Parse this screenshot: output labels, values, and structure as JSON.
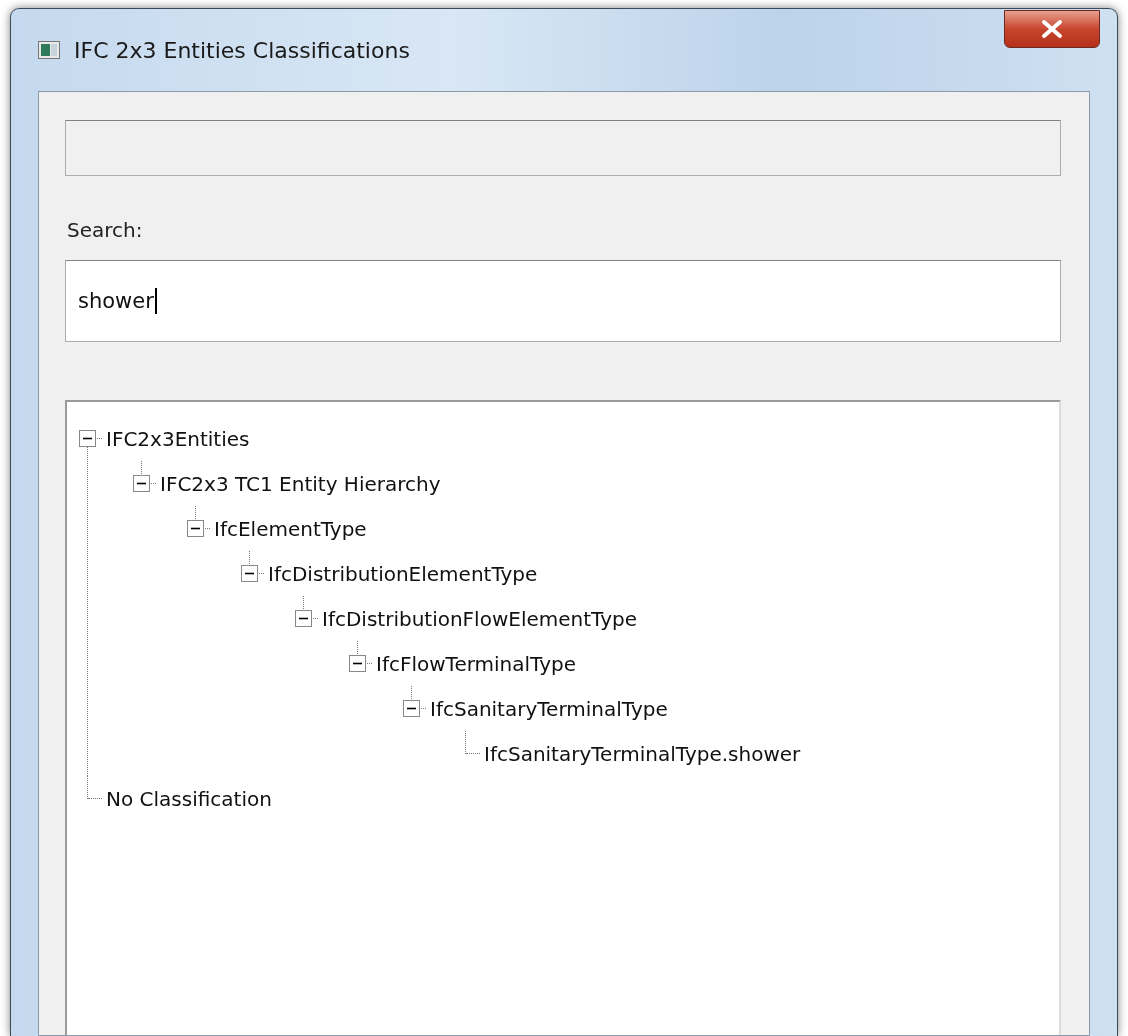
{
  "window": {
    "title": "IFC 2x3 Entities Classifications"
  },
  "status_field": {
    "disabled": true
  },
  "search": {
    "label": "Search:",
    "value": "shower",
    "focused": true
  },
  "tree": [
    {
      "label": "IFC2x3Entities",
      "expanded": true,
      "children": [
        {
          "label": "IFC2x3 TC1 Entity Hierarchy",
          "expanded": true,
          "children": [
            {
              "label": "IfcElementType",
              "expanded": true,
              "children": [
                {
                  "label": "IfcDistributionElementType",
                  "expanded": true,
                  "children": [
                    {
                      "label": "IfcDistributionFlowElementType",
                      "expanded": true,
                      "children": [
                        {
                          "label": "IfcFlowTerminalType",
                          "expanded": true,
                          "children": [
                            {
                              "label": "IfcSanitaryTerminalType",
                              "expanded": true,
                              "children": [
                                {
                                  "label": "IfcSanitaryTerminalType.shower"
                                }
                              ]
                            }
                          ]
                        }
                      ]
                    }
                  ]
                }
              ]
            }
          ]
        }
      ]
    },
    {
      "label": "No Classification"
    }
  ]
}
